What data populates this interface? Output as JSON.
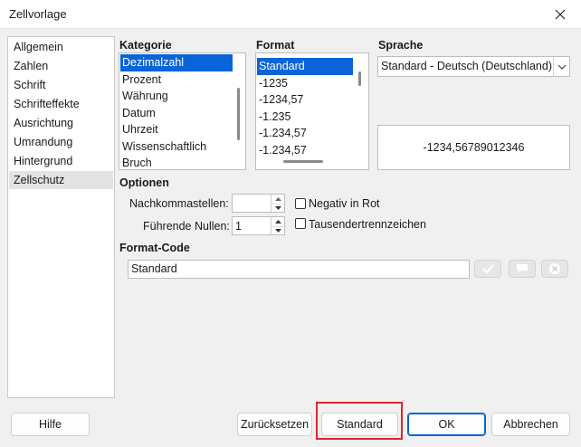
{
  "window": {
    "title": "Zellvorlage"
  },
  "sidebar": {
    "items": [
      {
        "label": "Allgemein"
      },
      {
        "label": "Zahlen"
      },
      {
        "label": "Schrift"
      },
      {
        "label": "Schrifteffekte"
      },
      {
        "label": "Ausrichtung"
      },
      {
        "label": "Umrandung"
      },
      {
        "label": "Hintergrund"
      },
      {
        "label": "Zellschutz"
      }
    ],
    "selected_index": 7
  },
  "kategorie": {
    "label": "Kategorie",
    "items": [
      "Dezimalzahl",
      "Prozent",
      "Währung",
      "Datum",
      "Uhrzeit",
      "Wissenschaftlich",
      "Bruch"
    ],
    "selected": "Dezimalzahl"
  },
  "format": {
    "label": "Format",
    "items": [
      "Standard",
      "-1235",
      "-1234,57",
      "-1.235",
      "-1.234,57",
      "-1.234,57"
    ],
    "selected": "Standard"
  },
  "sprache": {
    "label": "Sprache",
    "value": "Standard - Deutsch (Deutschland)"
  },
  "preview": {
    "text": "-1234,56789012346"
  },
  "optionen": {
    "label": "Optionen",
    "nachkommastellen_label": "Nachkommastellen:",
    "nachkommastellen_value": "",
    "fuehrende_nullen_label": "Führende Nullen:",
    "fuehrende_nullen_value": "1",
    "negativ_in_rot_label": "Negativ in Rot",
    "tausender_label": "Tausendertrennzeichen"
  },
  "format_code": {
    "label": "Format-Code",
    "value": "Standard"
  },
  "buttons": {
    "hilfe": "Hilfe",
    "zuruecksetzen": "Zurücksetzen",
    "standard": "Standard",
    "ok": "OK",
    "abbrechen": "Abbrechen"
  },
  "colors": {
    "selection": "#0a64d8",
    "highlight": "#e0262f"
  }
}
